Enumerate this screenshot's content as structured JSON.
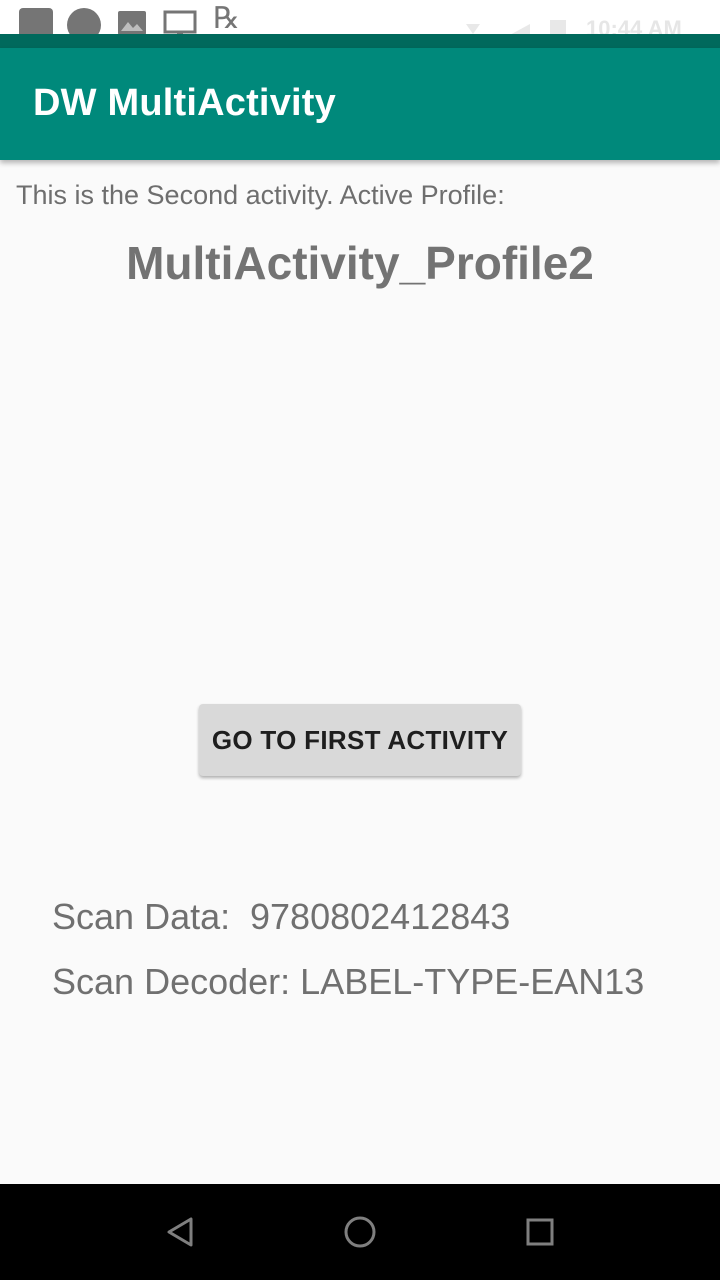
{
  "status_bar": {
    "icons": [
      "notification-square-icon",
      "notification-circle-icon",
      "photo-icon",
      "monitor-icon",
      "rx-icon",
      "wifi-icon",
      "signal-icon",
      "battery-icon"
    ],
    "rx_glyph": "℞",
    "time": "10:44 AM"
  },
  "app_bar": {
    "title": "DW MultiActivity",
    "color": "#00897b"
  },
  "main": {
    "intro_text": "This is the Second activity. Active Profile:",
    "profile_name": "MultiActivity_Profile2",
    "go_first_button_label": "GO TO FIRST ACTIVITY",
    "scan_data_label": "Scan Data:",
    "scan_data_value": "9780802412843",
    "scan_decoder_label": "Scan Decoder:",
    "scan_decoder_value": "LABEL-TYPE-EAN13"
  },
  "nav_bar": {
    "back": "back-icon",
    "home": "home-icon",
    "recent": "recent-apps-icon"
  }
}
